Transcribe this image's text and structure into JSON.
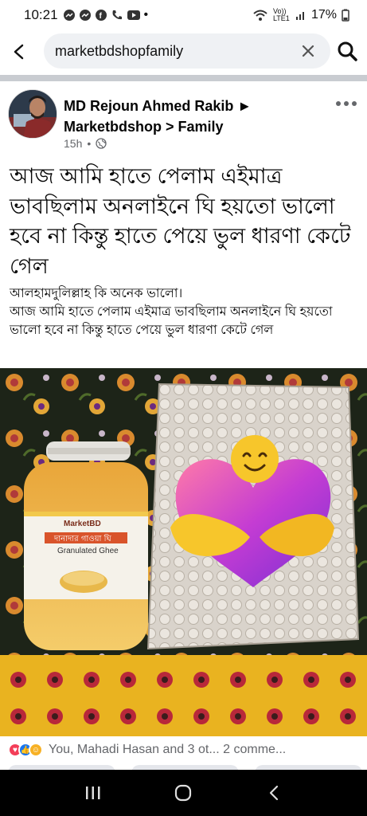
{
  "status_bar": {
    "time": "10:21",
    "network_label": "Vo)) LTE1",
    "battery": "17%"
  },
  "search": {
    "query": "marketbdshopfamily"
  },
  "post": {
    "author": "MD Rejoun Ahmed Rakib",
    "arrow": "►",
    "group": "Marketbdshop > Family",
    "time": "15h",
    "dot": "•",
    "title": "আজ আমি হাতে পেলাম এইমাত্র ভাবছিলাম অনলাইনে ঘি হয়তো ভালো হবে না কিন্তু হাতে পেয়ে ভুল ধারণা কেটে গেল",
    "body_line1": "আলহামদুলিল্লাহ কি অনেক ভালো।",
    "body_line2": "আজ আমি হাতে পেলাম এইমাত্র ভাবছিলাম অনলাইনে ঘি হয়তো ভালো হবে না কিন্তু হাতে পেয়ে ভুল ধারণা কেটে গেল",
    "photo": {
      "jar_brand": "MarketBD",
      "jar_label_bn": "দানাদার গাওয়া ঘি",
      "jar_label_en": "Granulated Ghee"
    },
    "reactions_summary": "You, Mahadi Hasan and 3 ot... 2 comme..."
  },
  "colors": {
    "like_blue": "#1877f2",
    "love_red": "#f33e58",
    "care_yellow": "#f7b125"
  }
}
